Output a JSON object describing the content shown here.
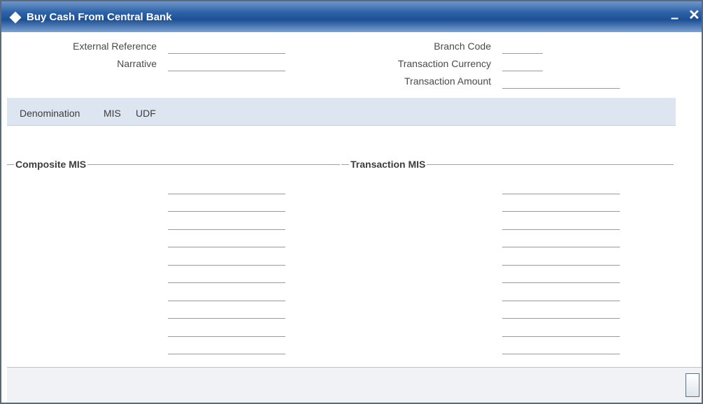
{
  "window": {
    "title": "Buy Cash From Central Bank",
    "minimize_symbol": "–",
    "close_symbol": "✕"
  },
  "header_fields": {
    "external_reference": {
      "label": "External Reference",
      "value": ""
    },
    "narrative": {
      "label": "Narrative",
      "value": ""
    },
    "branch_code": {
      "label": "Branch Code",
      "value": ""
    },
    "transaction_currency": {
      "label": "Transaction Currency",
      "value": ""
    },
    "transaction_amount": {
      "label": "Transaction Amount",
      "value": ""
    }
  },
  "tabs": [
    {
      "label": "Denomination"
    },
    {
      "label": "MIS"
    },
    {
      "label": "UDF"
    }
  ],
  "sections": {
    "composite_mis": {
      "title": "Composite MIS",
      "fields": [
        "",
        "",
        "",
        "",
        "",
        "",
        "",
        "",
        "",
        ""
      ]
    },
    "transaction_mis": {
      "title": "Transaction MIS",
      "fields": [
        "",
        "",
        "",
        "",
        "",
        "",
        "",
        "",
        "",
        ""
      ]
    }
  },
  "colors": {
    "title_bar": "#2f63a8",
    "tab_bar": "#dde5f0",
    "section_line": "#7fb0b8"
  }
}
